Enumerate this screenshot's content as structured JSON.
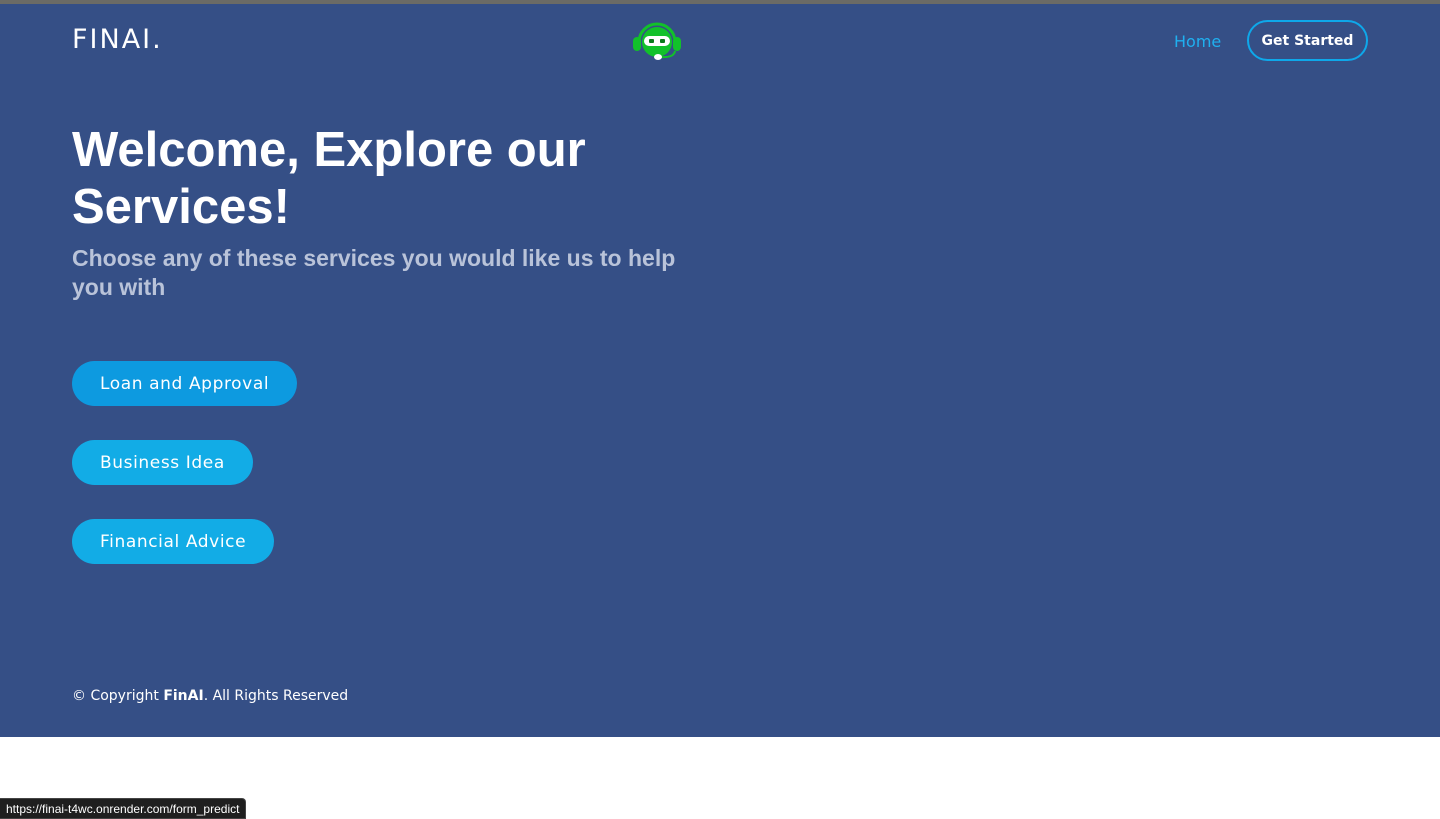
{
  "header": {
    "logo_text": "FINAI.",
    "bot_icon": "robot-headset-icon",
    "nav_home": "Home",
    "get_started": "Get Started"
  },
  "hero": {
    "title": "Welcome, Explore our Services!",
    "subtitle": "Choose any of these services you would like us to help you with"
  },
  "services": [
    {
      "label": "Loan and Approval"
    },
    {
      "label": "Business Idea"
    },
    {
      "label": "Financial Advice"
    }
  ],
  "footer": {
    "copyright_prefix": "© Copyright ",
    "brand": "FinAI",
    "copyright_suffix": ". All Rights Reserved"
  },
  "status_bar": {
    "url": "https://finai-t4wc.onrender.com/form_predict"
  },
  "colors": {
    "background": "#354f86",
    "accent": "#12ace6",
    "nav_link": "#1fb0f0",
    "bot_green": "#12c12a"
  }
}
